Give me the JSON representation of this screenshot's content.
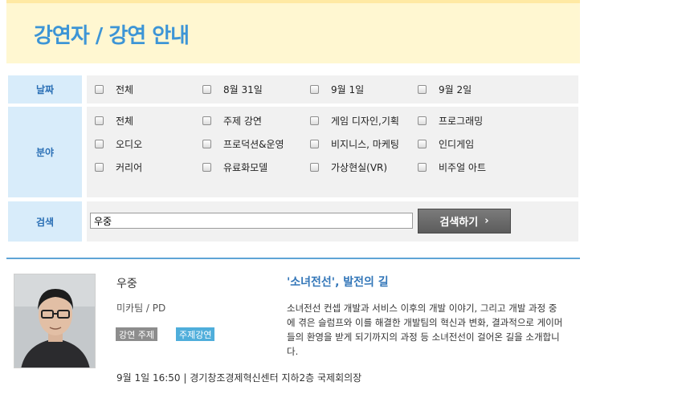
{
  "header": {
    "title": "강연자 / 강연 안내"
  },
  "filters": {
    "date": {
      "label": "날짜",
      "options": [
        "전체",
        "8월 31일",
        "9월 1일",
        "9월 2일"
      ]
    },
    "field": {
      "label": "분야",
      "options": [
        "전체",
        "주제 강연",
        "게임 디자인,기획",
        "프로그래밍",
        "오디오",
        "프로덕션&운영",
        "비지니스, 마케팅",
        "인디게임",
        "커리어",
        "유료화모델",
        "가상현실(VR)",
        "비주얼 아트"
      ]
    },
    "search": {
      "label": "검색",
      "value": "우중",
      "button_label": "검색하기",
      "button_arrow": "›"
    }
  },
  "result": {
    "speaker_name": "우중",
    "speaker_org": "미카팀 / PD",
    "badge_type": "강연 주제",
    "badge_category": "주제강연",
    "talk_title": "'소녀전선', 발전의 길",
    "talk_description": "소녀전선 컨셉 개발과 서비스 이후의 개발 이야기, 그리고 개발 과정 중에 겪은 슬럼프와 이를 해결한 개발팀의 혁신과 변화, 결과적으로 게이머들의 환영을 받게 되기까지의 과정 등 소녀전선이 걸어온 길을 소개합니다.",
    "talk_meta": "9월 1일 16:50 | 경기창조경제혁신센터 지하2층 국제회의장"
  },
  "colors": {
    "header_bg": "#fff7d1",
    "title_blue": "#3d95d6",
    "label_bg": "#d8ecfa",
    "divider": "#5fa4d6",
    "badge_gray": "#8d8d8d",
    "badge_blue": "#4faedb"
  },
  "icons": {
    "search_arrow": "chevron-right-icon",
    "checkbox": "checkbox-icon"
  }
}
